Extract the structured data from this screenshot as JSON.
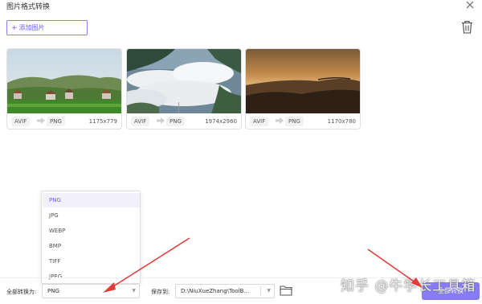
{
  "window": {
    "title": "图片格式转换"
  },
  "toolbar": {
    "add_label": "添加图片"
  },
  "cards": [
    {
      "source_format": "AVIF",
      "target_format": "PNG",
      "dimensions": "1175x779"
    },
    {
      "source_format": "AVIF",
      "target_format": "PNG",
      "dimensions": "1974x2960"
    },
    {
      "source_format": "AVIF",
      "target_format": "PNG",
      "dimensions": "1170x780"
    }
  ],
  "format_dropdown": {
    "options": [
      "PNG",
      "JPG",
      "WEBP",
      "BMP",
      "TIFF",
      "JPEG"
    ],
    "selected": "PNG"
  },
  "footer": {
    "convert_all_label": "全部转换为:",
    "format_value": "PNG",
    "save_to_label": "保存到:",
    "save_path": "D:\\NiuXueZhang\\ToolB...",
    "convert_button": "全部转换"
  },
  "watermark": "知乎 @牛学长工具箱",
  "colors": {
    "accent": "#7b6ef6",
    "annotation_arrow": "#e23b3b"
  }
}
